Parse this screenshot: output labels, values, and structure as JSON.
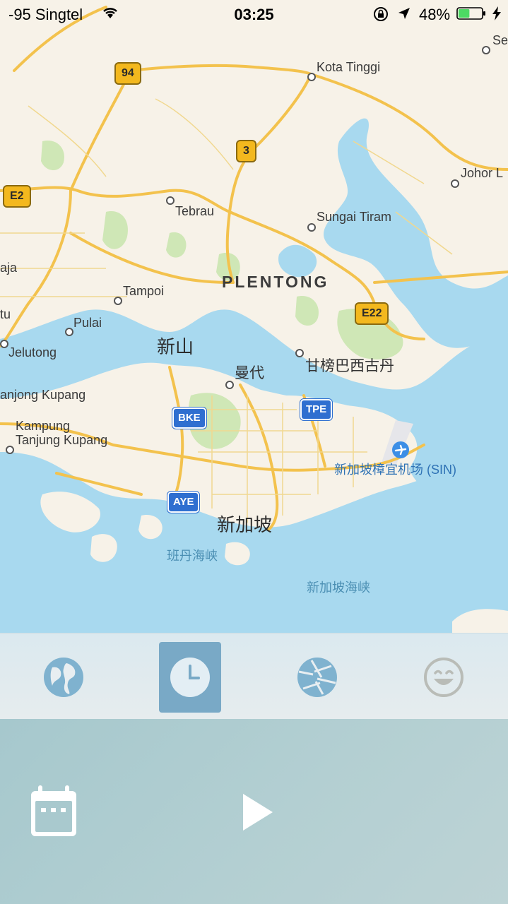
{
  "status_bar": {
    "carrier": "-95 Singtel",
    "time": "03:25",
    "battery_percent": "48%",
    "battery_level": 0.48,
    "battery_color": "#4cd964"
  },
  "map": {
    "colors": {
      "land": "#f7f2e8",
      "water": "#a8d9ef",
      "park": "#cfe7b6",
      "road": "#f5c542"
    },
    "route_shields": [
      {
        "label": "94",
        "style": "yellow"
      },
      {
        "label": "3",
        "style": "yellow"
      },
      {
        "label": "E2",
        "style": "yellow"
      },
      {
        "label": "E22",
        "style": "yellow"
      },
      {
        "label": "BKE",
        "style": "blue"
      },
      {
        "label": "TPE",
        "style": "blue"
      },
      {
        "label": "AYE",
        "style": "blue"
      }
    ],
    "places": {
      "kota_tinggi": "Kota Tinggi",
      "se": "Se",
      "johor_l": "Johor L",
      "tebrau": "Tebrau",
      "sungai_tiram": "Sungai Tiram",
      "plentong": "PLENTONG",
      "tampoi": "Tampoi",
      "aja": "aja",
      "tu": "tu",
      "pulai": "Pulai",
      "jelutong": "Jelutong",
      "johor_bahru_cn": "新山",
      "mandai_cn": "曼代",
      "pasir_gudang_cn": "甘榜巴西古丹",
      "tanjong_kupang": "anjong Kupang",
      "kampung": "Kampung",
      "tanjung_kupang": "Tanjung Kupang",
      "airport": "新加坡樟宜机场 (SIN)",
      "singapore_cn": "新加坡",
      "pandan_strait": "班丹海峡",
      "singapore_strait": "新加坡海峡"
    }
  },
  "tabs": [
    {
      "name": "globe-icon",
      "active": false
    },
    {
      "name": "clock-icon",
      "active": true
    },
    {
      "name": "aperture-icon",
      "active": false
    },
    {
      "name": "smiley-icon",
      "active": false
    }
  ],
  "controls": {
    "calendar_icon": "calendar-icon",
    "play_icon": "play-icon"
  }
}
